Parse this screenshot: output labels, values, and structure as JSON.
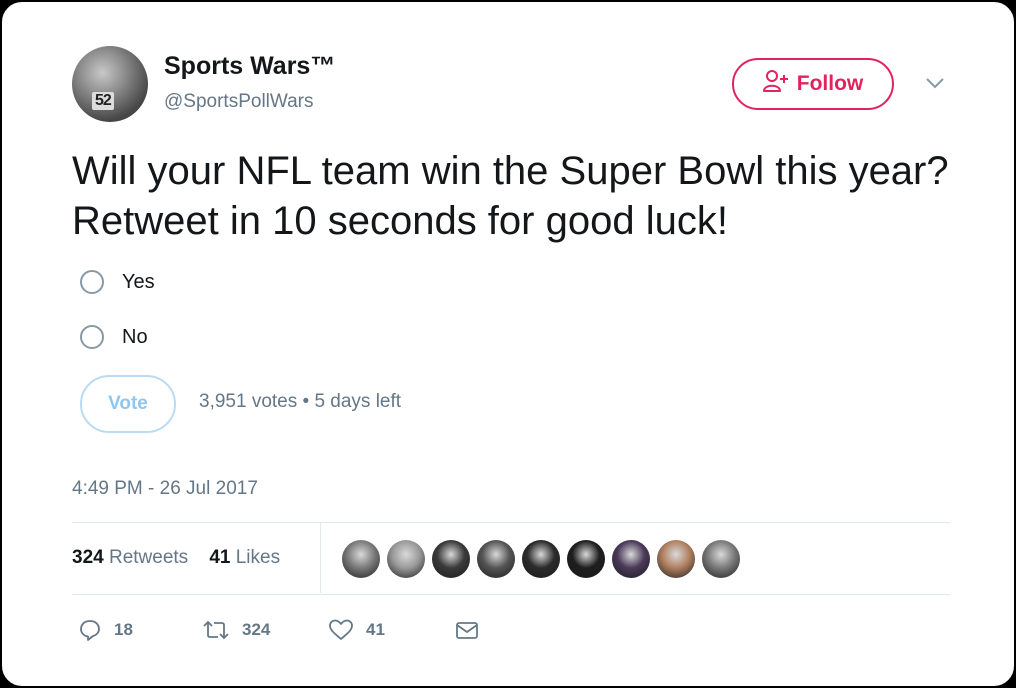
{
  "account": {
    "name": "Sports Wars™",
    "handle": "@SportsPollWars",
    "avatar_text": "52"
  },
  "follow_button": {
    "label": "Follow"
  },
  "tweet": {
    "text": "Will your NFL team win the Super Bowl this year? Retweet in 10 seconds for good luck!"
  },
  "poll": {
    "options": [
      {
        "label": "Yes"
      },
      {
        "label": "No"
      }
    ],
    "vote_label": "Vote",
    "meta": "3,951 votes • 5 days left"
  },
  "timestamp": "4:49 PM - 26 Jul 2017",
  "stats": {
    "retweets_count": "324",
    "retweets_label": "Retweets",
    "likes_count": "41",
    "likes_label": "Likes"
  },
  "likers": [
    {
      "color": "#7a7a7a"
    },
    {
      "color": "#9a9a9a"
    },
    {
      "color": "#3a3a3a"
    },
    {
      "color": "#555555"
    },
    {
      "color": "#2b2b2b"
    },
    {
      "color": "#1e1e1e"
    },
    {
      "color": "#4a3a5a"
    },
    {
      "color": "#b08060"
    },
    {
      "color": "#7a7a7a"
    }
  ],
  "actions": {
    "reply_count": "18",
    "retweet_count": "324",
    "like_count": "41"
  },
  "colors": {
    "follow_accent": "#e0245e",
    "vote_accent": "#8fc7f0",
    "secondary_text": "#657786"
  },
  "icons": [
    "follow-person-icon",
    "caret-down-icon",
    "reply-icon",
    "retweet-icon",
    "like-icon",
    "dm-icon"
  ]
}
